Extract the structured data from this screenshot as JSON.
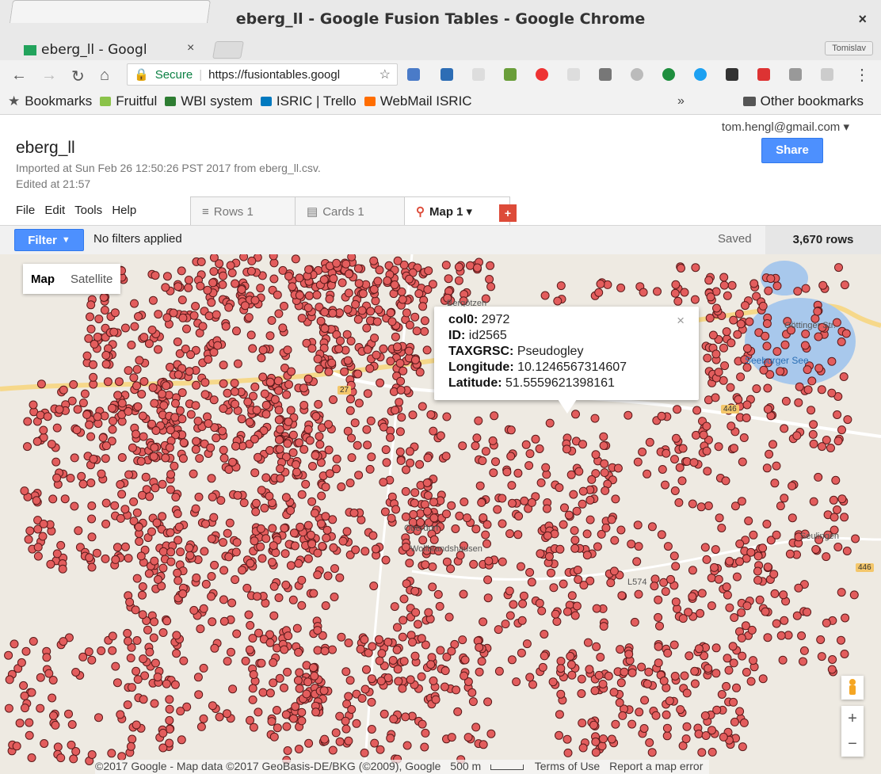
{
  "window": {
    "title": "eberg_ll - Google Fusion Tables - Google Chrome",
    "close": "×"
  },
  "browser": {
    "tab_title": "eberg_ll - Googl",
    "tab_close": "×",
    "profile": "Tomislav",
    "secure_label": "Secure",
    "url": "https://fusiontables.googl",
    "bookmarks": [
      "Bookmarks",
      "Fruitful",
      "WBI system",
      "ISRIC | Trello",
      "WebMail ISRIC"
    ],
    "overflow": "»",
    "other_bookmarks": "Other bookmarks"
  },
  "page": {
    "user": "tom.hengl@gmail.com ▾",
    "title": "eberg_ll",
    "share": "Share",
    "imported": "Imported at Sun Feb 26 12:50:26 PST 2017 from eberg_ll.csv.",
    "edited": "Edited at 21:57",
    "menus": [
      "File",
      "Edit",
      "Tools",
      "Help"
    ],
    "views": [
      {
        "label": "Rows 1"
      },
      {
        "label": "Cards 1"
      },
      {
        "label": "Map 1"
      }
    ],
    "add_view": "+"
  },
  "filterbar": {
    "filter": "Filter",
    "status": "No filters applied",
    "saved": "Saved",
    "rows": "3,670 rows"
  },
  "map": {
    "type_map": "Map",
    "type_satellite": "Satellite",
    "popup": {
      "col0_label": "col0:",
      "col0": "2972",
      "id_label": "ID:",
      "id": "id2565",
      "tax_label": "TAXGRSC:",
      "tax": "Pseudogley",
      "lon_label": "Longitude:",
      "lon": "10.1246567314607",
      "lat_label": "Latitude:",
      "lat": "51.5559621398161",
      "close": "×"
    },
    "labels": {
      "lake": "Seeburger See",
      "road_east": "Göttinger Str.",
      "oberdorf": "Oberdorf",
      "wollbrandshausen": "Wollbrandshausen",
      "seulingen": "Seulingen",
      "l574": "L574",
      "road446a": "446",
      "road446b": "446",
      "road27": "27",
      "bergoetzen": "Bergötzen"
    },
    "zoom_in": "+",
    "zoom_out": "−",
    "attribution": "©2017 Google - Map data ©2017 GeoBasis-DE/BKG (©2009), Google",
    "scale": "500 m",
    "terms": "Terms of Use",
    "report": "Report a map error",
    "marker_color": "#e35d5d",
    "lake_color": "#a8c8ec"
  }
}
